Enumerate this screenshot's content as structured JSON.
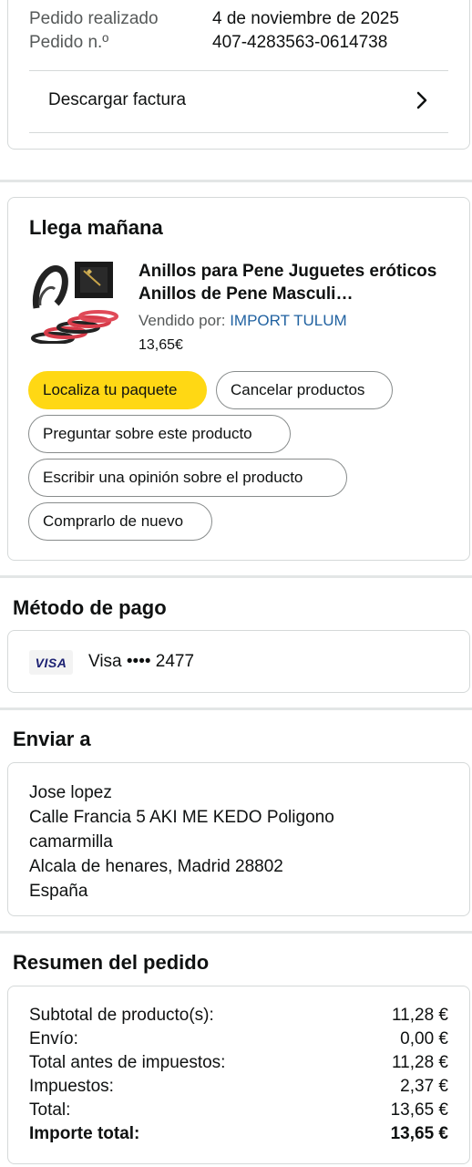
{
  "order_info": {
    "date_label": "Pedido realizado",
    "date_value": "4 de noviembre de 2025",
    "number_label": "Pedido n.º",
    "number_value": "407-4283563-0614738",
    "invoice_label": "Descargar factura"
  },
  "delivery": {
    "heading": "Llega mañana",
    "product_title": "Anillos para Pene Juguetes eróticos Anillos de Pene Masculi…",
    "sold_by_label": "Vendido por:",
    "seller": "IMPORT TULUM",
    "price": "13,65€",
    "buttons": {
      "track": "Localiza tu paquete",
      "cancel": "Cancelar productos",
      "ask": "Preguntar sobre este producto",
      "review": "Escribir una opinión sobre el producto",
      "buy_again": "Comprarlo de nuevo"
    }
  },
  "payment": {
    "heading": "Método de pago",
    "card_brand": "VISA",
    "card_text": "Visa •••• 2477"
  },
  "shipping": {
    "heading": "Enviar a",
    "name": "Jose lopez",
    "line1": "Calle Francia 5 AKI ME KEDO Poligono",
    "line2": "camarmilla",
    "line3": "Alcala de henares, Madrid 28802",
    "country": "España"
  },
  "summary": {
    "heading": "Resumen del pedido",
    "rows": [
      {
        "label": "Subtotal de producto(s):",
        "value": "11,28 €"
      },
      {
        "label": "Envío:",
        "value": "0,00 €"
      },
      {
        "label": "Total antes de impuestos:",
        "value": "11,28 €"
      },
      {
        "label": "Impuestos:",
        "value": "2,37 €"
      },
      {
        "label": "Total:",
        "value": "13,65 €"
      },
      {
        "label": "Importe total:",
        "value": "13,65 €"
      }
    ]
  },
  "colors": {
    "primary_button": "#ffd814",
    "link": "#2162a1",
    "visa_blue": "#1a1f71"
  }
}
